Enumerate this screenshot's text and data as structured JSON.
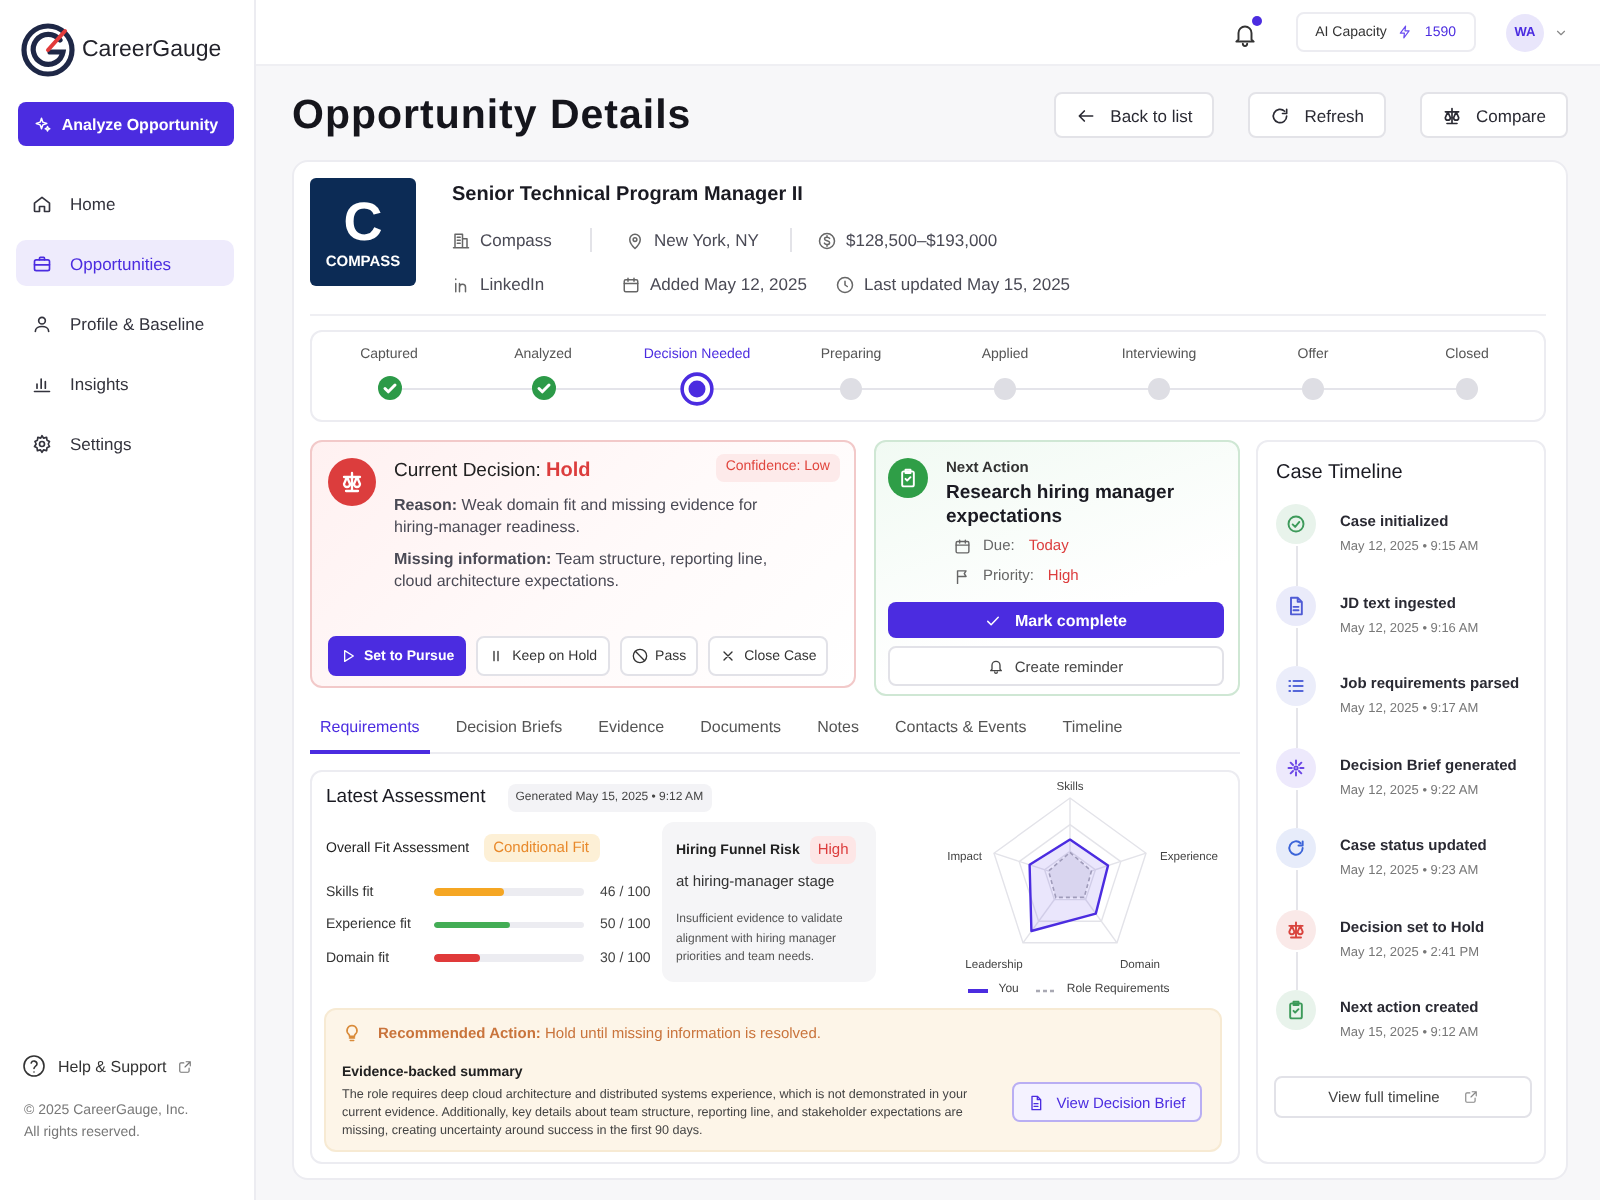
{
  "sidebar": {
    "brand": "CareerGauge",
    "cta": "Analyze Opportunity",
    "nav": [
      {
        "label": "Home",
        "selected": false
      },
      {
        "label": "Opportunities",
        "selected": true
      },
      {
        "label": "Profile & Baseline",
        "selected": false
      },
      {
        "label": "Insights",
        "selected": false
      },
      {
        "label": "Settings",
        "selected": false
      }
    ],
    "help": "Help & Support",
    "copyright": [
      "© 2025 CareerGauge, Inc.",
      "All rights reserved."
    ]
  },
  "topbar": {
    "unread_notifications": true,
    "capacity_label": "AI Capacity",
    "capacity_value": "1590",
    "avatar_initials": "WA"
  },
  "page": {
    "title": "Opportunity Details",
    "actions": [
      "Back to list",
      "Refresh",
      "Compare"
    ]
  },
  "job": {
    "logo_letter": "C",
    "logo_name": "COMPASS",
    "title": "Senior Technical Program Manager II",
    "company": "Compass",
    "location": "New York, NY",
    "salary": "$128,500–$193,000",
    "source": "LinkedIn",
    "added": "Added May 12, 2025",
    "updated": "Last updated May 15, 2025"
  },
  "stepper": [
    {
      "label": "Captured",
      "completed": true,
      "active": false
    },
    {
      "label": "Analyzed",
      "completed": true,
      "active": false
    },
    {
      "label": "Decision Needed",
      "completed": false,
      "active": true
    },
    {
      "label": "Preparing",
      "completed": false,
      "active": false
    },
    {
      "label": "Applied",
      "completed": false,
      "active": false
    },
    {
      "label": "Interviewing",
      "completed": false,
      "active": false
    },
    {
      "label": "Offer",
      "completed": false,
      "active": false
    },
    {
      "label": "Closed",
      "completed": false,
      "active": false
    }
  ],
  "decision": {
    "title": "Current Decision:",
    "value": "Hold",
    "confidence": "Confidence: Low",
    "reason": "**Reason:** Weak domain fit and missing evidence for hiring-manager readiness.",
    "missing": "**Missing information:** Team structure, reporting line, cloud architecture expectations.",
    "buttons": [
      {
        "label": "Set to Pursue",
        "kind": "primary"
      },
      {
        "label": "Keep on Hold",
        "kind": "secondary"
      },
      {
        "label": "Pass",
        "kind": "secondary"
      },
      {
        "label": "Close Case",
        "kind": "secondary"
      }
    ]
  },
  "next_action": {
    "label": "Next Action",
    "title": "Research hiring manager expectations",
    "due_label": "Due:",
    "due": "Today",
    "priority_label": "Priority:",
    "priority": "High",
    "complete_button": "Mark complete",
    "reminder_button": "Create reminder"
  },
  "tabs": [
    {
      "label": "Requirements",
      "selected": true
    },
    {
      "label": "Decision Briefs",
      "selected": false
    },
    {
      "label": "Evidence",
      "selected": false
    },
    {
      "label": "Documents",
      "selected": false
    },
    {
      "label": "Notes",
      "selected": false
    },
    {
      "label": "Contacts & Events",
      "selected": false
    },
    {
      "label": "Timeline",
      "selected": false
    }
  ],
  "assessment": {
    "title": "Latest Assessment",
    "generated": "Generated May 15, 2025 • 9:12 AM",
    "overall_label": "Overall Fit Assessment",
    "overall_value": "Conditional Fit",
    "fit": [
      {
        "label": "Skills fit",
        "level": 0.46,
        "reading": "46 / 100",
        "color": "#f5a623"
      },
      {
        "label": "Experience fit",
        "level": 0.5,
        "reading": "50 / 100",
        "color": "#43ad55"
      },
      {
        "label": "Domain fit",
        "level": 0.3,
        "reading": "30 / 100",
        "color": "#e03a3a"
      }
    ],
    "risk": {
      "title": "Hiring Funnel Risk",
      "badge": "High",
      "subtitle": "at hiring-manager stage",
      "text": "Insufficient evidence to validate alignment with hiring manager priorities and team needs."
    },
    "radar": {
      "axes": [
        "Skills",
        "Experience",
        "Domain",
        "Leadership",
        "Impact"
      ],
      "legend": [
        "You",
        "Role Requirements"
      ]
    },
    "recommendation": {
      "text": "**Recommended Action:** Hold until missing information is resolved.",
      "summary_title": "Evidence-backed summary",
      "summary": "The role requires deep cloud architecture and distributed systems experience, which is not demonstrated in your current evidence. Additionally, key details about team structure, reporting line, and stakeholder expectations are missing, creating uncertainty around success in the first 90 days.",
      "button": "View Decision Brief"
    }
  },
  "timeline": {
    "title": "Case Timeline",
    "events": [
      {
        "title": "Case initialized",
        "time": "May 12, 2025 • 9:15 AM"
      },
      {
        "title": "JD text ingested",
        "time": "May 12, 2025 • 9:16 AM"
      },
      {
        "title": "Job requirements parsed",
        "time": "May 12, 2025 • 9:17 AM"
      },
      {
        "title": "Decision Brief generated",
        "time": "May 12, 2025 • 9:22 AM"
      },
      {
        "title": "Case status updated",
        "time": "May 12, 2025 • 9:23 AM"
      },
      {
        "title": "Decision set to Hold",
        "time": "May 12, 2025 • 2:41 PM"
      },
      {
        "title": "Next action created",
        "time": "May 15, 2025 • 9:12 AM"
      }
    ],
    "button": "View full timeline"
  }
}
